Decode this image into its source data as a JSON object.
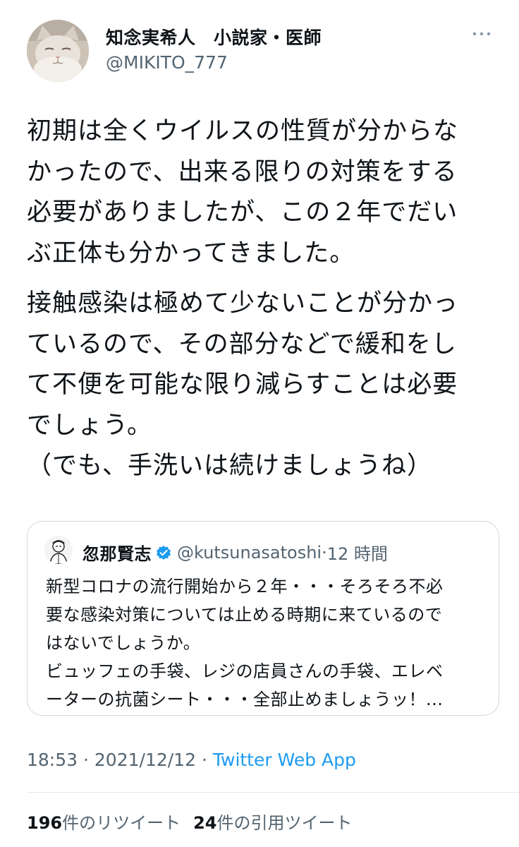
{
  "author": {
    "name": "知念実希人　小説家・医師",
    "handle": "@MIKITO_777"
  },
  "tweet": {
    "paragraph1": "初期は全くウイルスの性質が分からな\nかったので、出来る限りの対策をする\n必要がありましたが、この２年でだい\nぶ正体も分かってきました。",
    "paragraph2": "接触感染は極めて少ないことが分かっ\nているので、その部分などで緩和をし\nて不便を可能な限り減らすことは必要\nでしょう。\n（でも、手洗いは続けましょうね）"
  },
  "quoted": {
    "name": "忽那賢志",
    "handle": "@kutsunasatoshi",
    "separator": "·",
    "time": "12 時間",
    "text": "新型コロナの流行開始から２年・・・そろそろ不必\n要な感染対策については止める時期に来ているので\nはないでしょうか。\nビュッフェの手袋、レジの店員さんの手袋、エレベ\nーターの抗菌シート・・・全部止めましょうッ！..."
  },
  "meta": {
    "time": "18:53",
    "date": "2021/12/12",
    "separator": "·",
    "source": "Twitter Web App"
  },
  "stats": {
    "retweets_count": "196",
    "retweets_label": "件のリツイート",
    "quotes_count": "24",
    "quotes_label": "件の引用ツイート"
  },
  "icons": {
    "more": "more-icon",
    "verified": "verified-badge-icon",
    "avatar": "cat-avatar",
    "quoted_avatar": "illustrated-doctor-avatar"
  },
  "colors": {
    "text": "#0f1419",
    "secondary": "#536471",
    "link": "#1d9bf0",
    "border": "#cfd9de"
  }
}
